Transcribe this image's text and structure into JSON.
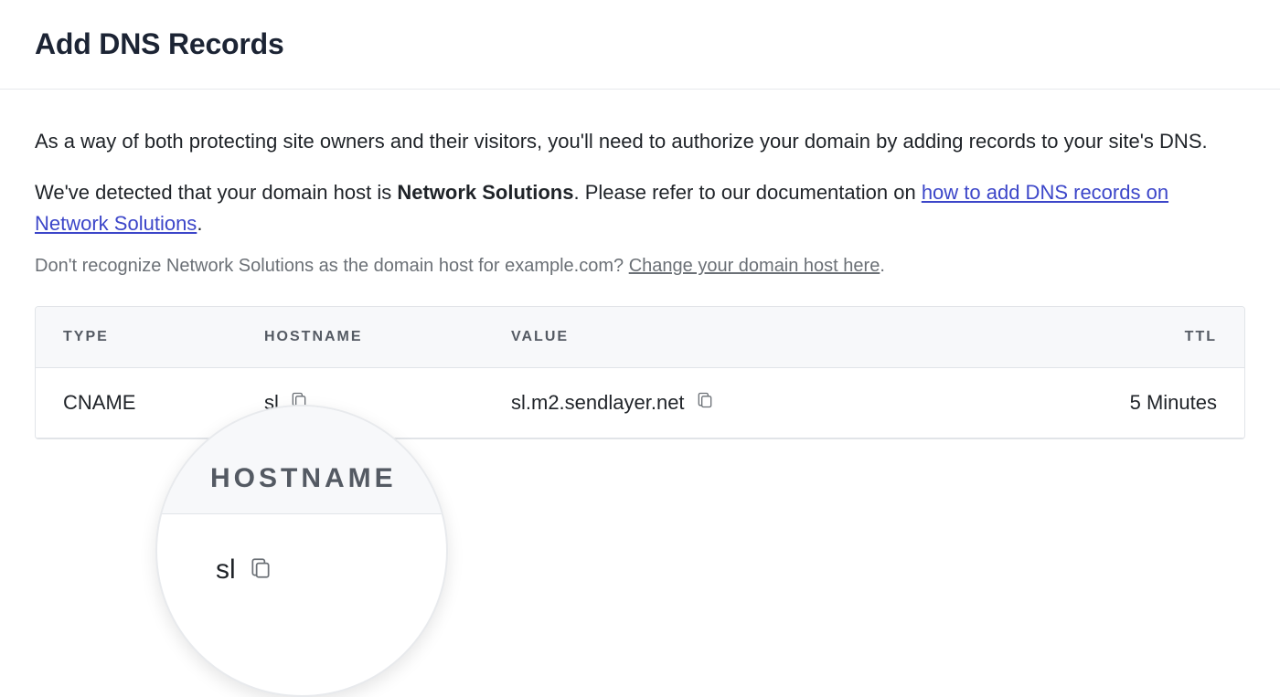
{
  "header": {
    "title": "Add DNS Records"
  },
  "intro": "As a way of both protecting site owners and their visitors, you'll need to authorize your domain by adding records to your site's DNS.",
  "detected": {
    "prefix": "We've detected that your domain host is ",
    "host": "Network Solutions",
    "mid": ". Please refer to our documentation on ",
    "link_text": "how to add DNS records on Network Solutions",
    "suffix": "."
  },
  "unrecognize": {
    "prefix": "Don't recognize Network Solutions as the domain host for example.com? ",
    "link_text": "Change your domain host here",
    "suffix": "."
  },
  "table": {
    "headers": {
      "type": "TYPE",
      "hostname": "HOSTNAME",
      "value": "VALUE",
      "ttl": "TTL"
    },
    "row": {
      "type": "CNAME",
      "hostname": "sl",
      "value": "sl.m2.sendlayer.net",
      "ttl": "5 Minutes"
    }
  },
  "lens": {
    "header": "HOSTNAME",
    "hostname": "sl"
  }
}
